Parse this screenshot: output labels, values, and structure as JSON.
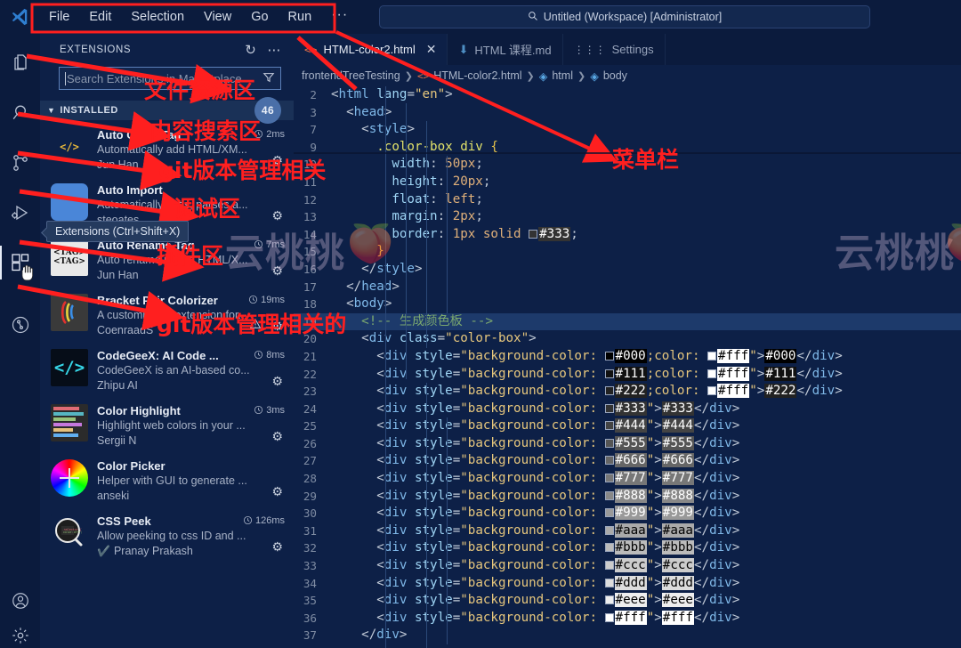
{
  "titlebar": {
    "logo_icon": "vscode-logo-icon",
    "menus": [
      "File",
      "Edit",
      "Selection",
      "View",
      "Go",
      "Run",
      "···"
    ],
    "back_icon": "arrow-left-icon",
    "forward_icon": "arrow-right-icon",
    "command_center": {
      "search_icon": "search-icon",
      "text": "Untitled (Workspace) [Administrator]"
    }
  },
  "activitybar": {
    "items": [
      {
        "name": "explorer-icon",
        "label": "Explorer"
      },
      {
        "name": "search-icon",
        "label": "Search"
      },
      {
        "name": "source-control-icon",
        "label": "Source Control"
      },
      {
        "name": "run-debug-icon",
        "label": "Run and Debug"
      },
      {
        "name": "extensions-icon",
        "label": "Extensions"
      },
      {
        "name": "testing-icon",
        "label": "Testing"
      }
    ],
    "bottom": [
      {
        "name": "account-icon",
        "label": "Accounts"
      },
      {
        "name": "settings-gear-icon",
        "label": "Manage"
      }
    ]
  },
  "sidebar": {
    "title": "EXTENSIONS",
    "refresh_icon": "refresh-icon",
    "more_icon": "more-actions-icon",
    "search": {
      "placeholder": "Search Extensions in Marketplace",
      "filter_icon": "filter-icon"
    },
    "section": {
      "label": "INSTALLED",
      "chevron": "chevron-down-icon",
      "count": "46"
    },
    "extensions": [
      {
        "name": "Auto Close Tag",
        "time": "2ms",
        "description": "Automatically add HTML/XM...",
        "publisher": "Jun Han",
        "icon": "auto-close-tag-icon",
        "verified": false,
        "warning": false
      },
      {
        "name": "Auto Import",
        "time": "",
        "description": "Automatically finds, parses a...",
        "publisher": "steoates",
        "icon": "auto-import-icon",
        "verified": false,
        "warning": false
      },
      {
        "name": "Auto Rename Tag",
        "time": "7ms",
        "description": "Auto rename paired HTML/X...",
        "publisher": "Jun Han",
        "icon": "auto-rename-tag-icon",
        "verified": false,
        "warning": false
      },
      {
        "name": "Bracket Pair Colorizer",
        "time": "19ms",
        "description": "A customizable extension for...",
        "publisher": "CoenraadS",
        "icon": "bracket-pair-colorizer-icon",
        "verified": false,
        "warning": true
      },
      {
        "name": "CodeGeeX: AI Code ...",
        "time": "8ms",
        "description": "CodeGeeX is an AI-based co...",
        "publisher": "Zhipu AI",
        "icon": "codegeex-icon",
        "verified": false,
        "warning": false
      },
      {
        "name": "Color Highlight",
        "time": "3ms",
        "description": "Highlight web colors in your ...",
        "publisher": "Sergii N",
        "icon": "color-highlight-icon",
        "verified": false,
        "warning": false
      },
      {
        "name": "Color Picker",
        "time": "",
        "description": "Helper with GUI to generate ...",
        "publisher": "anseki",
        "icon": "color-picker-icon",
        "verified": false,
        "warning": false
      },
      {
        "name": "CSS Peek",
        "time": "126ms",
        "description": "Allow peeking to css ID and ...",
        "publisher": "Pranay Prakash",
        "icon": "css-peek-icon",
        "verified": true,
        "warning": false
      }
    ]
  },
  "editor": {
    "tabs": [
      {
        "label": "HTML-color2.html",
        "icon": "html-file-icon",
        "active": true,
        "close_icon": "close-icon"
      },
      {
        "label": "HTML 课程.md",
        "icon": "markdown-file-icon",
        "active": false
      },
      {
        "label": "Settings",
        "icon": "settings-tab-icon",
        "active": false
      }
    ],
    "breadcrumb": [
      "frontendTreeTesting",
      "HTML-color2.html",
      "html",
      "body"
    ],
    "code_lines": [
      {
        "n": "2",
        "html": "<span class='tk-brk'>&lt;</span><span class='tk-tag'>html</span> <span class='tk-attr'>lang</span><span class='tk-brk'>=</span><span class='tk-str'>\"en\"</span><span class='tk-brk'>&gt;</span>",
        "indent": 0
      },
      {
        "n": "3",
        "html": "  <span class='tk-brk'>&lt;</span><span class='tk-tag'>head</span><span class='tk-brk'>&gt;</span>",
        "indent": 0
      },
      {
        "n": "7",
        "html": "    <span class='tk-brk'>&lt;</span><span class='tk-tag'>style</span><span class='tk-brk'>&gt;</span>",
        "indent": 0
      },
      {
        "n": "9",
        "html": "      <span class='tk-sel'>.color-box div</span> <span class='tk-brace'>{</span>",
        "indent": 0
      },
      {
        "n": "10",
        "html": "        <span class='tk-prop'>width</span><span class='tk-punc'>:</span> <span class='tk-val'>50px</span><span class='tk-punc'>;</span>",
        "indent": 0
      },
      {
        "n": "11",
        "html": "        <span class='tk-prop'>height</span><span class='tk-punc'>:</span> <span class='tk-val'>20px</span><span class='tk-punc'>;</span>",
        "indent": 0
      },
      {
        "n": "12",
        "html": "        <span class='tk-prop'>float</span><span class='tk-punc'>:</span> <span class='tk-val'>left</span><span class='tk-punc'>;</span>",
        "indent": 0
      },
      {
        "n": "13",
        "html": "        <span class='tk-prop'>margin</span><span class='tk-punc'>:</span> <span class='tk-val'>2px</span><span class='tk-punc'>;</span>",
        "indent": 0
      },
      {
        "n": "14",
        "html": "        <span class='tk-prop'>border</span><span class='tk-punc'>:</span> <span class='tk-val'>1px solid</span> <span class='swatch' style='background:#333333'></span><span class='cbg' style='background:#333333;color:#ffffff'>#333</span><span class='tk-punc'>;</span>",
        "indent": 0
      },
      {
        "n": "15",
        "html": "      <span class='tk-brace'>}</span>",
        "indent": 0
      },
      {
        "n": "16",
        "html": "    <span class='tk-brk'>&lt;/</span><span class='tk-tag'>style</span><span class='tk-brk'>&gt;</span>",
        "indent": 0
      },
      {
        "n": "17",
        "html": "  <span class='tk-brk'>&lt;/</span><span class='tk-tag'>head</span><span class='tk-brk'>&gt;</span>",
        "indent": 0
      },
      {
        "n": "18",
        "html": "  <span class='tk-brk'>&lt;</span><span class='tk-tag'>body</span><span class='tk-brk'>&gt;</span>",
        "indent": 0
      },
      {
        "n": "19",
        "html": "    <span class='tk-cmt'>&lt;!-- 生成颜色板 --&gt;</span>",
        "indent": 0,
        "hl": true
      },
      {
        "n": "20",
        "html": "    <span class='tk-brk'>&lt;</span><span class='tk-tag'>div</span> <span class='tk-attr'>class</span><span class='tk-brk'>=</span><span class='tk-str'>\"color-box\"</span><span class='tk-brk'>&gt;</span>",
        "indent": 0
      },
      {
        "n": "21",
        "html": "      <span class='tk-brk'>&lt;</span><span class='tk-tag'>div</span> <span class='tk-attr'>style</span><span class='tk-brk'>=</span><span class='tk-str'>\"background-color:</span> <span class='swatch' style='background:#000000'></span><span class='cbg' style='background:#000000;color:#ffffff'>#000</span><span class='tk-str'>;color:</span> <span class='swatch' style='background:#ffffff'></span><span class='cbg' style='background:#ffffff;color:#000000'>#fff</span><span class='tk-str'>\"</span><span class='tk-brk'>&gt;</span><span class='cbg' style='background:#000000;color:#ffffff'>#000</span><span class='tk-brk'>&lt;/</span><span class='tk-tag'>div</span><span class='tk-brk'>&gt;</span>",
        "indent": 0
      },
      {
        "n": "22",
        "html": "      <span class='tk-brk'>&lt;</span><span class='tk-tag'>div</span> <span class='tk-attr'>style</span><span class='tk-brk'>=</span><span class='tk-str'>\"background-color:</span> <span class='swatch' style='background:#111111'></span><span class='cbg' style='background:#111111;color:#ffffff'>#111</span><span class='tk-str'>;color:</span> <span class='swatch' style='background:#ffffff'></span><span class='cbg' style='background:#ffffff;color:#000000'>#fff</span><span class='tk-str'>\"</span><span class='tk-brk'>&gt;</span><span class='cbg' style='background:#111111;color:#ffffff'>#111</span><span class='tk-brk'>&lt;/</span><span class='tk-tag'>div</span><span class='tk-brk'>&gt;</span>",
        "indent": 0
      },
      {
        "n": "23",
        "html": "      <span class='tk-brk'>&lt;</span><span class='tk-tag'>div</span> <span class='tk-attr'>style</span><span class='tk-brk'>=</span><span class='tk-str'>\"background-color:</span> <span class='swatch' style='background:#222222'></span><span class='cbg' style='background:#222222;color:#ffffff'>#222</span><span class='tk-str'>;color:</span> <span class='swatch' style='background:#ffffff'></span><span class='cbg' style='background:#ffffff;color:#000000'>#fff</span><span class='tk-str'>\"</span><span class='tk-brk'>&gt;</span><span class='cbg' style='background:#222222;color:#ffffff'>#222</span><span class='tk-brk'>&lt;/</span><span class='tk-tag'>div</span><span class='tk-brk'>&gt;</span>",
        "indent": 0
      },
      {
        "n": "24",
        "html": "      <span class='tk-brk'>&lt;</span><span class='tk-tag'>div</span> <span class='tk-attr'>style</span><span class='tk-brk'>=</span><span class='tk-str'>\"background-color:</span> <span class='swatch' style='background:#333333'></span><span class='cbg' style='background:#333333;color:#ffffff'>#333</span><span class='tk-str'>\"</span><span class='tk-brk'>&gt;</span><span class='cbg' style='background:#333333;color:#ffffff'>#333</span><span class='tk-brk'>&lt;/</span><span class='tk-tag'>div</span><span class='tk-brk'>&gt;</span>",
        "indent": 0
      },
      {
        "n": "25",
        "html": "      <span class='tk-brk'>&lt;</span><span class='tk-tag'>div</span> <span class='tk-attr'>style</span><span class='tk-brk'>=</span><span class='tk-str'>\"background-color:</span> <span class='swatch' style='background:#444444'></span><span class='cbg' style='background:#444444;color:#ffffff'>#444</span><span class='tk-str'>\"</span><span class='tk-brk'>&gt;</span><span class='cbg' style='background:#444444;color:#ffffff'>#444</span><span class='tk-brk'>&lt;/</span><span class='tk-tag'>div</span><span class='tk-brk'>&gt;</span>",
        "indent": 0
      },
      {
        "n": "26",
        "html": "      <span class='tk-brk'>&lt;</span><span class='tk-tag'>div</span> <span class='tk-attr'>style</span><span class='tk-brk'>=</span><span class='tk-str'>\"background-color:</span> <span class='swatch' style='background:#555555'></span><span class='cbg' style='background:#555555;color:#ffffff'>#555</span><span class='tk-str'>\"</span><span class='tk-brk'>&gt;</span><span class='cbg' style='background:#555555;color:#ffffff'>#555</span><span class='tk-brk'>&lt;/</span><span class='tk-tag'>div</span><span class='tk-brk'>&gt;</span>",
        "indent": 0
      },
      {
        "n": "27",
        "html": "      <span class='tk-brk'>&lt;</span><span class='tk-tag'>div</span> <span class='tk-attr'>style</span><span class='tk-brk'>=</span><span class='tk-str'>\"background-color:</span> <span class='swatch' style='background:#666666'></span><span class='cbg' style='background:#666666;color:#ffffff'>#666</span><span class='tk-str'>\"</span><span class='tk-brk'>&gt;</span><span class='cbg' style='background:#666666;color:#ffffff'>#666</span><span class='tk-brk'>&lt;/</span><span class='tk-tag'>div</span><span class='tk-brk'>&gt;</span>",
        "indent": 0
      },
      {
        "n": "28",
        "html": "      <span class='tk-brk'>&lt;</span><span class='tk-tag'>div</span> <span class='tk-attr'>style</span><span class='tk-brk'>=</span><span class='tk-str'>\"background-color:</span> <span class='swatch' style='background:#777777'></span><span class='cbg' style='background:#777777;color:#ffffff'>#777</span><span class='tk-str'>\"</span><span class='tk-brk'>&gt;</span><span class='cbg' style='background:#777777;color:#ffffff'>#777</span><span class='tk-brk'>&lt;/</span><span class='tk-tag'>div</span><span class='tk-brk'>&gt;</span>",
        "indent": 0
      },
      {
        "n": "29",
        "html": "      <span class='tk-brk'>&lt;</span><span class='tk-tag'>div</span> <span class='tk-attr'>style</span><span class='tk-brk'>=</span><span class='tk-str'>\"background-color:</span> <span class='swatch' style='background:#888888'></span><span class='cbg' style='background:#888888;color:#ffffff'>#888</span><span class='tk-str'>\"</span><span class='tk-brk'>&gt;</span><span class='cbg' style='background:#888888;color:#ffffff'>#888</span><span class='tk-brk'>&lt;/</span><span class='tk-tag'>div</span><span class='tk-brk'>&gt;</span>",
        "indent": 0
      },
      {
        "n": "30",
        "html": "      <span class='tk-brk'>&lt;</span><span class='tk-tag'>div</span> <span class='tk-attr'>style</span><span class='tk-brk'>=</span><span class='tk-str'>\"background-color:</span> <span class='swatch' style='background:#999999'></span><span class='cbg' style='background:#999999;color:#ffffff'>#999</span><span class='tk-str'>\"</span><span class='tk-brk'>&gt;</span><span class='cbg' style='background:#999999;color:#ffffff'>#999</span><span class='tk-brk'>&lt;/</span><span class='tk-tag'>div</span><span class='tk-brk'>&gt;</span>",
        "indent": 0
      },
      {
        "n": "31",
        "html": "      <span class='tk-brk'>&lt;</span><span class='tk-tag'>div</span> <span class='tk-attr'>style</span><span class='tk-brk'>=</span><span class='tk-str'>\"background-color:</span> <span class='swatch' style='background:#aaaaaa'></span><span class='cbg' style='background:#aaaaaa;color:#000000'>#aaa</span><span class='tk-str'>\"</span><span class='tk-brk'>&gt;</span><span class='cbg' style='background:#aaaaaa;color:#000000'>#aaa</span><span class='tk-brk'>&lt;/</span><span class='tk-tag'>div</span><span class='tk-brk'>&gt;</span>",
        "indent": 0
      },
      {
        "n": "32",
        "html": "      <span class='tk-brk'>&lt;</span><span class='tk-tag'>div</span> <span class='tk-attr'>style</span><span class='tk-brk'>=</span><span class='tk-str'>\"background-color:</span> <span class='swatch' style='background:#bbbbbb'></span><span class='cbg' style='background:#bbbbbb;color:#000000'>#bbb</span><span class='tk-str'>\"</span><span class='tk-brk'>&gt;</span><span class='cbg' style='background:#bbbbbb;color:#000000'>#bbb</span><span class='tk-brk'>&lt;/</span><span class='tk-tag'>div</span><span class='tk-brk'>&gt;</span>",
        "indent": 0
      },
      {
        "n": "33",
        "html": "      <span class='tk-brk'>&lt;</span><span class='tk-tag'>div</span> <span class='tk-attr'>style</span><span class='tk-brk'>=</span><span class='tk-str'>\"background-color:</span> <span class='swatch' style='background:#cccccc'></span><span class='cbg' style='background:#cccccc;color:#000000'>#ccc</span><span class='tk-str'>\"</span><span class='tk-brk'>&gt;</span><span class='cbg' style='background:#cccccc;color:#000000'>#ccc</span><span class='tk-brk'>&lt;/</span><span class='tk-tag'>div</span><span class='tk-brk'>&gt;</span>",
        "indent": 0
      },
      {
        "n": "34",
        "html": "      <span class='tk-brk'>&lt;</span><span class='tk-tag'>div</span> <span class='tk-attr'>style</span><span class='tk-brk'>=</span><span class='tk-str'>\"background-color:</span> <span class='swatch' style='background:#dddddd'></span><span class='cbg' style='background:#dddddd;color:#000000'>#ddd</span><span class='tk-str'>\"</span><span class='tk-brk'>&gt;</span><span class='cbg' style='background:#dddddd;color:#000000'>#ddd</span><span class='tk-brk'>&lt;/</span><span class='tk-tag'>div</span><span class='tk-brk'>&gt;</span>",
        "indent": 0
      },
      {
        "n": "35",
        "html": "      <span class='tk-brk'>&lt;</span><span class='tk-tag'>div</span> <span class='tk-attr'>style</span><span class='tk-brk'>=</span><span class='tk-str'>\"background-color:</span> <span class='swatch' style='background:#eeeeee'></span><span class='cbg' style='background:#eeeeee;color:#000000'>#eee</span><span class='tk-str'>\"</span><span class='tk-brk'>&gt;</span><span class='cbg' style='background:#eeeeee;color:#000000'>#eee</span><span class='tk-brk'>&lt;/</span><span class='tk-tag'>div</span><span class='tk-brk'>&gt;</span>",
        "indent": 0
      },
      {
        "n": "36",
        "html": "      <span class='tk-brk'>&lt;</span><span class='tk-tag'>div</span> <span class='tk-attr'>style</span><span class='tk-brk'>=</span><span class='tk-str'>\"background-color:</span> <span class='swatch' style='background:#ffffff'></span><span class='cbg' style='background:#ffffff;color:#000000'>#fff</span><span class='tk-str'>\"</span><span class='tk-brk'>&gt;</span><span class='cbg' style='background:#ffffff;color:#000000'>#fff</span><span class='tk-brk'>&lt;/</span><span class='tk-tag'>div</span><span class='tk-brk'>&gt;</span>",
        "indent": 0
      },
      {
        "n": "37",
        "html": "    <span class='tk-brk'>&lt;/</span><span class='tk-tag'>div</span><span class='tk-brk'>&gt;</span>",
        "indent": 0
      }
    ]
  },
  "watermarks": [
    {
      "text": "云桃桃",
      "peach": "🍑"
    },
    {
      "text": "云桃桃",
      "peach": "🍑"
    }
  ],
  "annotations": {
    "tooltip": "Extensions (Ctrl+Shift+X)",
    "labels": [
      {
        "text": "文件资源区"
      },
      {
        "text": "内容搜索区"
      },
      {
        "text": "git版本管理相关"
      },
      {
        "text": "调试区"
      },
      {
        "text": "插件区"
      },
      {
        "text": "git版本管理相关的"
      },
      {
        "text": "菜单栏"
      }
    ]
  },
  "colors": {
    "accent": "#ff1f1f",
    "editor_bg": "#0d2047",
    "chrome_bg": "#0b1b3d",
    "highlight_line": "#1d3a6b"
  }
}
